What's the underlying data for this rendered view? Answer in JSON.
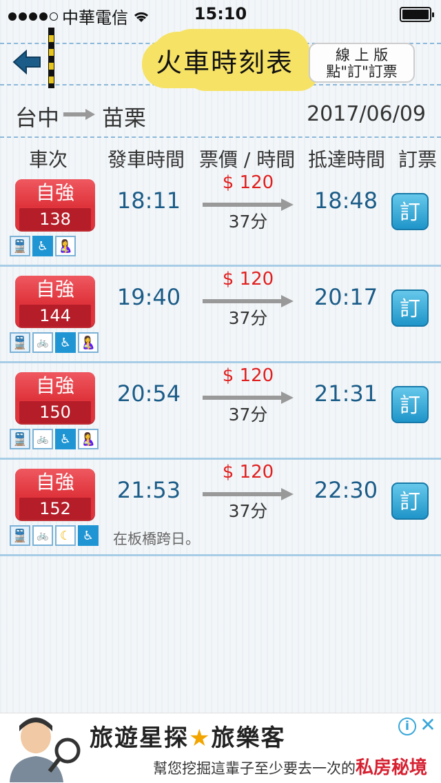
{
  "status_bar": {
    "carrier": "中華電信",
    "time": "15:10"
  },
  "header": {
    "title": "火車時刻表",
    "online_line1": "線 上 版",
    "online_line2": "點\"訂\"訂票"
  },
  "route": {
    "from": "台中",
    "to": "苗栗",
    "date": "2017/06/09"
  },
  "columns": {
    "train": "車次",
    "departure": "發車時間",
    "price_time": "票價 / 時間",
    "arrival": "抵達時間",
    "book": "訂票"
  },
  "trains": [
    {
      "type": "自強",
      "number": "138",
      "departure": "18:11",
      "price": "$ 120",
      "duration": "37分",
      "arrival": "18:48",
      "book": "訂",
      "icons": [
        "rail-icon",
        "wheelchair-icon",
        "nursing-icon"
      ],
      "note": ""
    },
    {
      "type": "自強",
      "number": "144",
      "departure": "19:40",
      "price": "$ 120",
      "duration": "37分",
      "arrival": "20:17",
      "book": "訂",
      "icons": [
        "rail-icon",
        "bicycle-icon",
        "wheelchair-icon",
        "nursing-icon"
      ],
      "note": ""
    },
    {
      "type": "自強",
      "number": "150",
      "departure": "20:54",
      "price": "$ 120",
      "duration": "37分",
      "arrival": "21:31",
      "book": "訂",
      "icons": [
        "rail-icon",
        "bicycle-icon",
        "wheelchair-icon",
        "nursing-icon"
      ],
      "note": ""
    },
    {
      "type": "自強",
      "number": "152",
      "departure": "21:53",
      "price": "$ 120",
      "duration": "37分",
      "arrival": "22:30",
      "book": "訂",
      "icons": [
        "rail-icon",
        "bicycle-icon",
        "night-icon",
        "wheelchair-icon"
      ],
      "note": "在板橋跨日。"
    }
  ],
  "ad": {
    "line1_a": "旅遊星探",
    "star": "★",
    "line1_b": "旅樂客",
    "line2_a": "幫您挖掘這輩子至少要去一次的",
    "line2_b": "私房秘境"
  }
}
